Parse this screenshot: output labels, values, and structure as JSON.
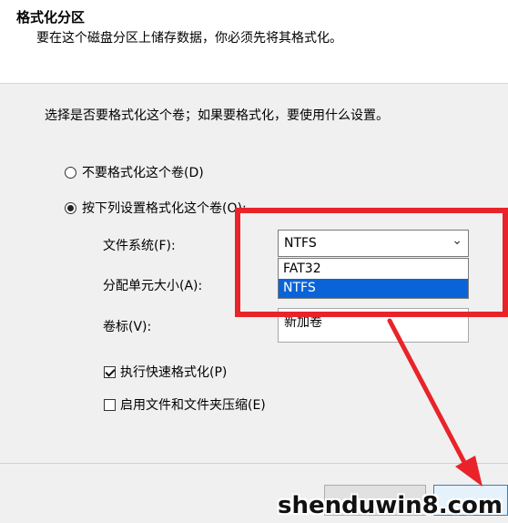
{
  "header": {
    "title": "格式化分区",
    "subtitle": "要在这个磁盘分区上储存数据，你必须先将其格式化。"
  },
  "main": {
    "question": "选择是否要格式化这个卷；如果要格式化，要使用什么设置。",
    "radio_no_format": "不要格式化这个卷(D)",
    "radio_format": "按下列设置格式化这个卷(O):",
    "file_system_label": "文件系统(F):",
    "file_system_value": "NTFS",
    "file_system_options": [
      "FAT32",
      "NTFS"
    ],
    "allocation_label": "分配单元大小(A):",
    "volume_label_label": "卷标(V):",
    "volume_label_value": "新加卷",
    "quick_format_label": "执行快速格式化(P)",
    "quick_format_checked": true,
    "compression_label": "启用文件和文件夹压缩(E)",
    "compression_checked": false
  },
  "colors": {
    "highlight": "#e8242a",
    "selection": "#0a64d8"
  },
  "watermark": "shenduwin8.com"
}
